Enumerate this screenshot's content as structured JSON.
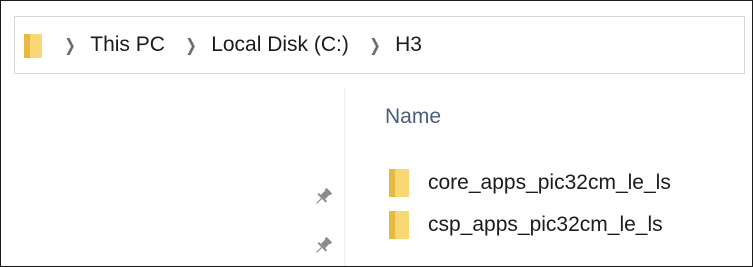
{
  "address_bar": {
    "breadcrumbs": [
      "This PC",
      "Local Disk (C:)",
      "H3"
    ]
  },
  "file_list": {
    "column_header": "Name",
    "items": [
      {
        "name": "core_apps_pic32cm_le_ls",
        "icon": "folder-icon"
      },
      {
        "name": "csp_apps_pic32cm_le_ls",
        "icon": "folder-icon"
      }
    ]
  },
  "nav_pane": {
    "pinned_icons": [
      "pin-icon",
      "pin-icon"
    ]
  },
  "colors": {
    "folder_yellow": "#f8d775",
    "folder_shade": "#e9b83f",
    "header_text": "#4a5e7a"
  }
}
